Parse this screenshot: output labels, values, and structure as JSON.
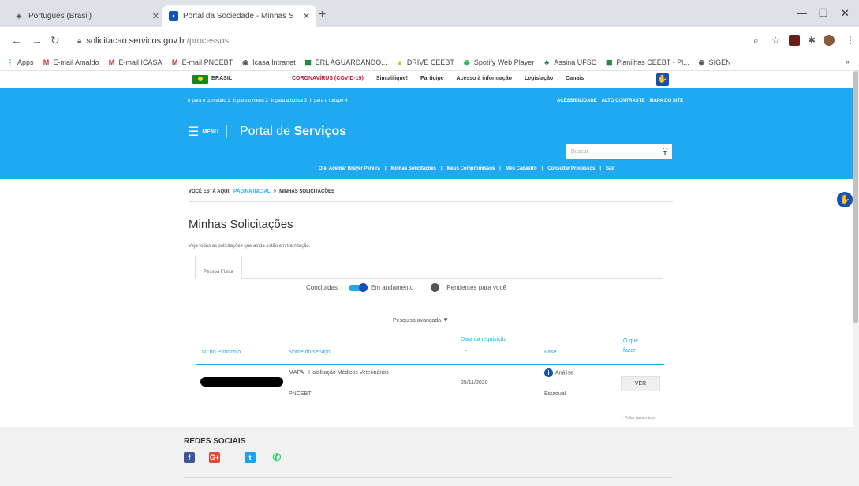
{
  "browser": {
    "tabs": [
      {
        "title": "Português (Brasil)",
        "active": false
      },
      {
        "title": "Portal da Sociedade - Minhas S...",
        "active": true
      }
    ],
    "url_host": "solicitacao.servicos.gov.br",
    "url_path": "/processos",
    "bookmarks": [
      {
        "label": "Apps",
        "icon": "apps-grid-icon",
        "color": "#4285f4"
      },
      {
        "label": "E-mail Amaldo",
        "icon": "gmail-icon",
        "color": "#d93025"
      },
      {
        "label": "E-mail ICASA",
        "icon": "gmail-icon",
        "color": "#d93025"
      },
      {
        "label": "E-mail PNCEBT",
        "icon": "gmail-icon",
        "color": "#d93025"
      },
      {
        "label": "Icasa Intranet",
        "icon": "globe-icon",
        "color": "#555555"
      },
      {
        "label": "ERL AGUARDANDO...",
        "icon": "sheets-icon",
        "color": "#188038"
      },
      {
        "label": "DRIVE CEEBT",
        "icon": "drive-icon",
        "color": "#f4b400"
      },
      {
        "label": "Spotify Web Player",
        "icon": "spotify-icon",
        "color": "#1db954"
      },
      {
        "label": "Assina UFSC",
        "icon": "assina-icon",
        "color": "#188038"
      },
      {
        "label": "Planilhas CEEBT - Pl...",
        "icon": "sheets-icon",
        "color": "#188038"
      },
      {
        "label": "SIGEN",
        "icon": "globe-icon",
        "color": "#555555"
      }
    ]
  },
  "govbar": {
    "brasil": "BRASIL",
    "links": [
      "CORONAVÍRUS (COVID-19)",
      "Simplifique!",
      "Participe",
      "Acesso à informação",
      "Legislação",
      "Canais"
    ]
  },
  "header": {
    "skiplinks": [
      "Ir para o conteúdo 1",
      "Ir para o menu 2",
      "Ir para a busca 3",
      "Ir para o rodapé 4"
    ],
    "acclinks": [
      "ACESSIBILIDADE",
      "ALTO CONTRASTE",
      "MAPA DO SITE"
    ],
    "menu_label": "MENU",
    "portal_prefix": "Portal de ",
    "portal_bold": "Serviços",
    "search_placeholder": "Buscar",
    "userbar": [
      "Olá, Ademar Brayer Pereira",
      "Minhas Solicitações",
      "Meus Compromissos",
      "Meu Cadastro",
      "Consultar Processos",
      "Sair"
    ]
  },
  "main": {
    "breadcrumb_prefix": "VOCÊ ESTÁ AQUI:",
    "breadcrumb_home": "PÁGINA INICIAL",
    "breadcrumb_sep": ">",
    "breadcrumb_current": "MINHAS SOLICITAÇÕES",
    "title": "Minhas Solicitações",
    "subtitle": "Veja todas as solicitações que ainda estão em tramitação.",
    "tab": "Pessoa Física",
    "filters": {
      "concluidas": "Concluídas",
      "em_andamento": "Em andamento",
      "pendentes": "Pendentes para você"
    },
    "advanced_search": "Pesquisa avançada",
    "table": {
      "headers": {
        "protocolo": "N° do Protocolo",
        "servico": "Nome do serviço",
        "data1": "Data da requisição",
        "data2": "⌄",
        "fase": "Fase",
        "oque1": "O que",
        "oque2": "fazer"
      },
      "row": {
        "servico1": "MAPA - Habilitação Médicos Veterinários",
        "servico2": "PNCEBT",
        "data": "25/11/2020",
        "fase1": "Análise",
        "fase2": "Estadual",
        "action": "VER"
      }
    },
    "back_to_top": "↑ Voltar para o topo"
  },
  "footer": {
    "redes": "REDES SOCIAIS",
    "social": [
      {
        "icon": "facebook-icon",
        "color": "#3b5998",
        "glyph": "f"
      },
      {
        "icon": "google-plus-icon",
        "color": "#dd4b39",
        "glyph": "G+"
      },
      {
        "icon": "twitter-icon",
        "color": "#1da1f2",
        "glyph": "t"
      },
      {
        "icon": "whatsapp-icon",
        "color": "#25d366",
        "glyph": "✆"
      }
    ]
  }
}
